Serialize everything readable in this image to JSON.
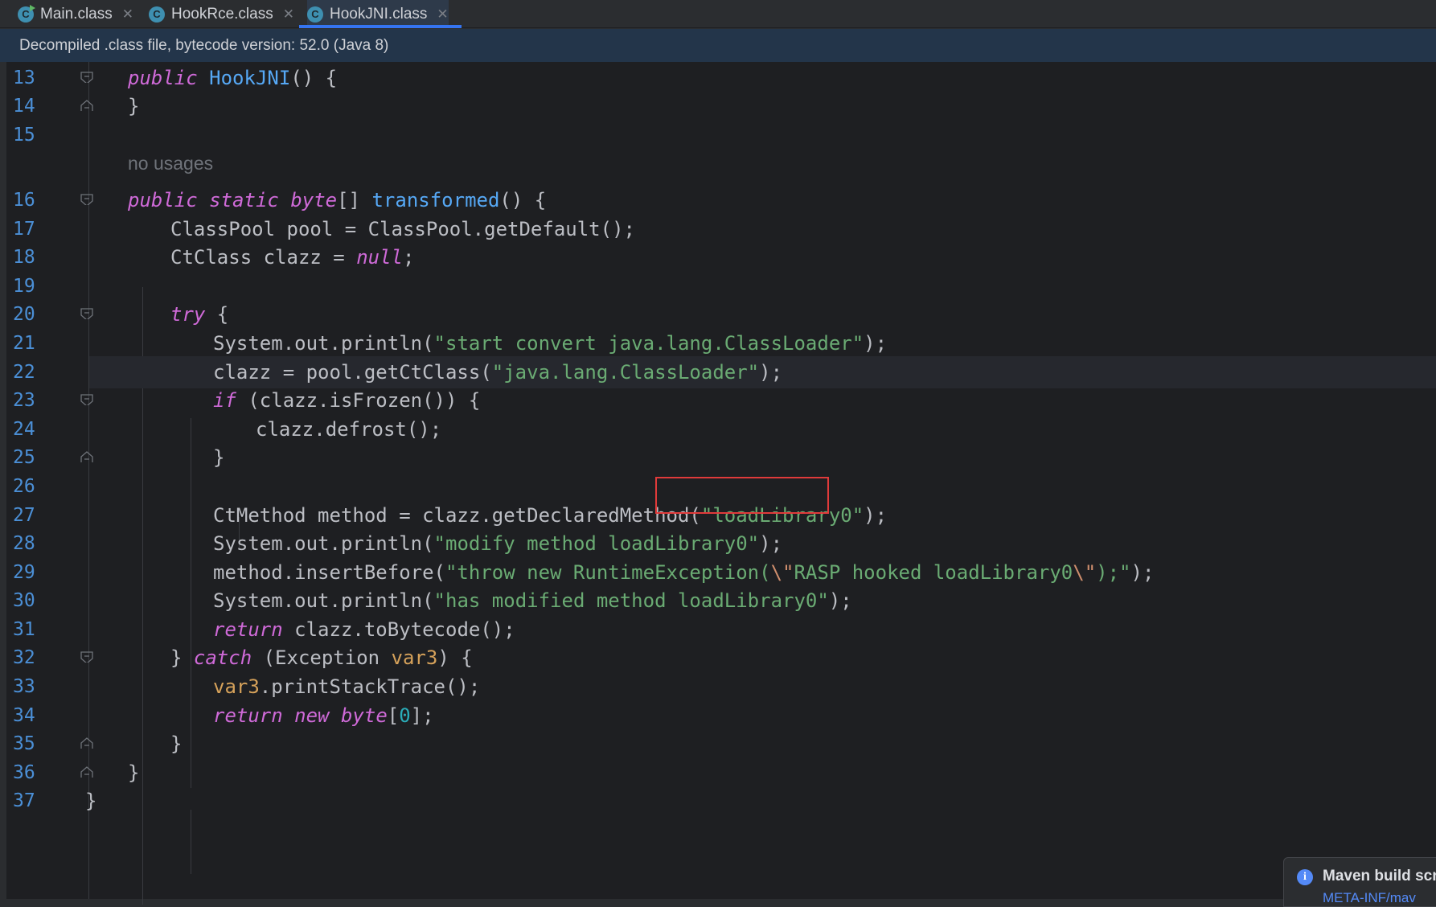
{
  "tabs": [
    {
      "label": "Main.class",
      "icon": "class-run-icon",
      "active": false
    },
    {
      "label": "HookRce.class",
      "icon": "class-icon",
      "active": false
    },
    {
      "label": "HookJNI.class",
      "icon": "class-icon",
      "active": true
    }
  ],
  "banner": {
    "text": "Decompiled .class file, bytecode version: 52.0 (Java 8)"
  },
  "editor": {
    "hint": "no usages",
    "highlighted_text": "\"loadLibrary0\");",
    "lines": [
      {
        "num": "13",
        "code": "public HookJNI() {"
      },
      {
        "num": "14",
        "code": "}"
      },
      {
        "num": "15",
        "code": ""
      },
      {
        "num": "16",
        "code": "public static byte[] transformed() {"
      },
      {
        "num": "17",
        "code": "ClassPool pool = ClassPool.getDefault();"
      },
      {
        "num": "18",
        "code": "CtClass clazz = null;"
      },
      {
        "num": "19",
        "code": ""
      },
      {
        "num": "20",
        "code": "try {"
      },
      {
        "num": "21",
        "code": "System.out.println(\"start convert java.lang.ClassLoader\");"
      },
      {
        "num": "22",
        "code": "clazz = pool.getCtClass(\"java.lang.ClassLoader\");"
      },
      {
        "num": "23",
        "code": "if (clazz.isFrozen()) {"
      },
      {
        "num": "24",
        "code": "clazz.defrost();"
      },
      {
        "num": "25",
        "code": "}"
      },
      {
        "num": "26",
        "code": ""
      },
      {
        "num": "27",
        "code": "CtMethod method = clazz.getDeclaredMethod(\"loadLibrary0\");"
      },
      {
        "num": "28",
        "code": "System.out.println(\"modify method loadLibrary0\");"
      },
      {
        "num": "29",
        "code": "method.insertBefore(\"throw new RuntimeException(\\\"RASP hooked loadLibrary0\\\");\");"
      },
      {
        "num": "30",
        "code": "System.out.println(\"has modified method loadLibrary0\");"
      },
      {
        "num": "31",
        "code": "return clazz.toBytecode();"
      },
      {
        "num": "32",
        "code": "} catch (Exception var3) {"
      },
      {
        "num": "33",
        "code": "var3.printStackTrace();"
      },
      {
        "num": "34",
        "code": "return new byte[0];"
      },
      {
        "num": "35",
        "code": "}"
      },
      {
        "num": "36",
        "code": "}"
      },
      {
        "num": "37",
        "code": "}"
      }
    ]
  },
  "notification": {
    "title": "Maven build scr",
    "link": "META-INF/mav"
  }
}
